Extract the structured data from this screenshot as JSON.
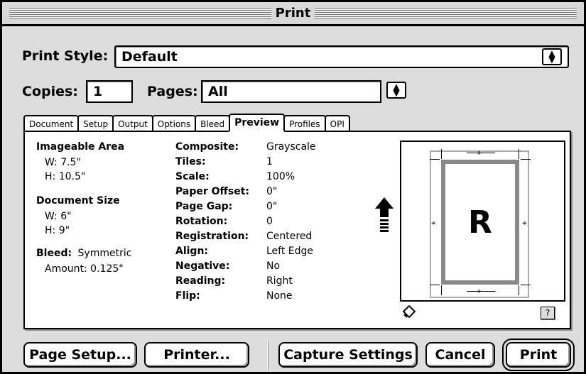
{
  "window": {
    "title": "Print"
  },
  "print_style": {
    "label": "Print Style:",
    "value": "Default"
  },
  "copies": {
    "label": "Copies:",
    "value": "1"
  },
  "pages": {
    "label": "Pages:",
    "value": "All"
  },
  "tabs": [
    {
      "label": "Document"
    },
    {
      "label": "Setup"
    },
    {
      "label": "Output"
    },
    {
      "label": "Options"
    },
    {
      "label": "Bleed"
    },
    {
      "label": "Preview",
      "active": true
    },
    {
      "label": "Profiles"
    },
    {
      "label": "OPI"
    }
  ],
  "preview": {
    "imageable_area": {
      "heading": "Imageable Area",
      "w": "W: 7.5\"",
      "h": "H: 10.5\""
    },
    "document_size": {
      "heading": "Document Size",
      "w": "W: 6\"",
      "h": "H: 9\""
    },
    "bleed": {
      "label": "Bleed:",
      "value": "Symmetric",
      "amount": "Amount: 0.125\""
    },
    "settings": [
      {
        "label": "Composite:",
        "value": "Grayscale"
      },
      {
        "label": "Tiles:",
        "value": "1"
      },
      {
        "label": "Scale:",
        "value": "100%"
      },
      {
        "label": "Paper Offset:",
        "value": "0\""
      },
      {
        "label": "Page Gap:",
        "value": "0\""
      },
      {
        "label": "Rotation:",
        "value": "0"
      },
      {
        "label": "Registration:",
        "value": "Centered"
      },
      {
        "label": "Align:",
        "value": "Left Edge"
      },
      {
        "label": "Negative:",
        "value": "No"
      },
      {
        "label": "Reading:",
        "value": "Right"
      },
      {
        "label": "Flip:",
        "value": "None"
      }
    ],
    "page_letter": "R",
    "help": "?"
  },
  "buttons": {
    "page_setup": "Page Setup...",
    "printer": "Printer...",
    "capture": "Capture Settings",
    "cancel": "Cancel",
    "print": "Print"
  }
}
